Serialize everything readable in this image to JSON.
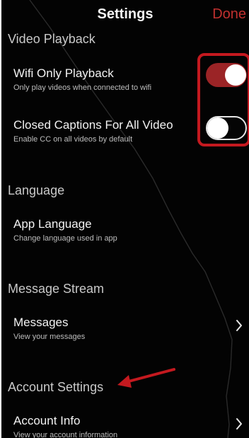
{
  "nav": {
    "title": "Settings",
    "done_label": "Done"
  },
  "sections": {
    "video_playback": {
      "header": "Video Playback",
      "wifi_only": {
        "title": "Wifi Only Playback",
        "subtitle": "Only play videos when connected to wifi",
        "enabled": true
      },
      "closed_captions": {
        "title": "Closed Captions For All Video",
        "subtitle": "Enable CC on all videos by default",
        "enabled": false
      }
    },
    "language": {
      "header": "Language",
      "app_language": {
        "title": "App Language",
        "subtitle": "Change language used in app"
      }
    },
    "message_stream": {
      "header": "Message Stream",
      "messages": {
        "title": "Messages",
        "subtitle": "View your messages"
      }
    },
    "account_settings": {
      "header": "Account Settings",
      "account_info": {
        "title": "Account Info",
        "subtitle": "View your account information"
      }
    }
  },
  "colors": {
    "background": "#030303",
    "accent": "#c0302f",
    "toggle_on": "#9b2426",
    "annotation": "#c4191f"
  },
  "icons": {
    "chevron": "chevron-right-icon",
    "annotation_arrow": "arrow-left-icon"
  }
}
